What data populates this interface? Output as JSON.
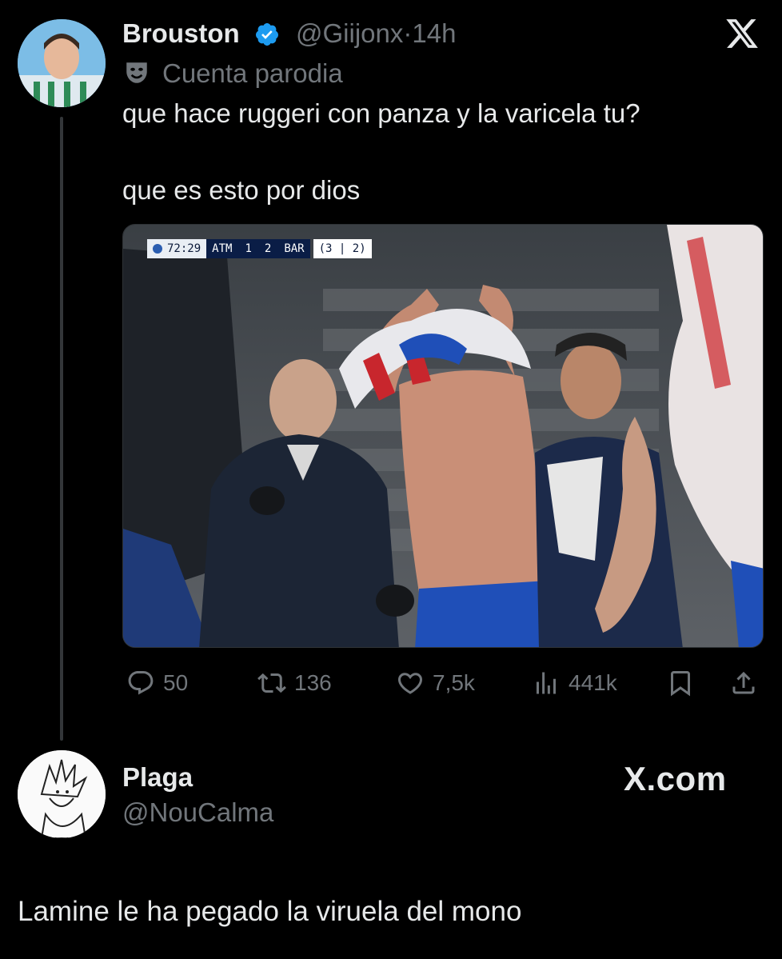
{
  "tweet": {
    "author_name": "Brouston",
    "author_handle": "@Giijonx",
    "separator": "·",
    "time_ago": "14h",
    "verified_icon": "verified-badge-icon",
    "parody_icon": "theater-mask-icon",
    "parody_label": "Cuenta parodia",
    "text_line_1": "que hace ruggeri con panza y la varicela tu?",
    "text_line_2": "que es esto por dios",
    "media": {
      "scorebug": {
        "clock": "72:29",
        "home": "ATM",
        "home_score": "1",
        "away_score": "2",
        "away": "BAR",
        "aggregate": "(3 | 2)"
      }
    },
    "actions": {
      "replies": "50",
      "retweets": "136",
      "likes": "7,5k",
      "views": "441k"
    }
  },
  "reply": {
    "author_name": "Plaga",
    "author_handle": "@NouCalma",
    "text": "Lamine le ha pegado la viruela del mono"
  },
  "branding": {
    "x_logo": "x-logo-icon",
    "site": "X.com"
  },
  "colors": {
    "background": "#000000",
    "text_primary": "#e7e9ea",
    "text_secondary": "#71767b",
    "verified_blue": "#1d9bf0",
    "thread_line": "#333639"
  }
}
